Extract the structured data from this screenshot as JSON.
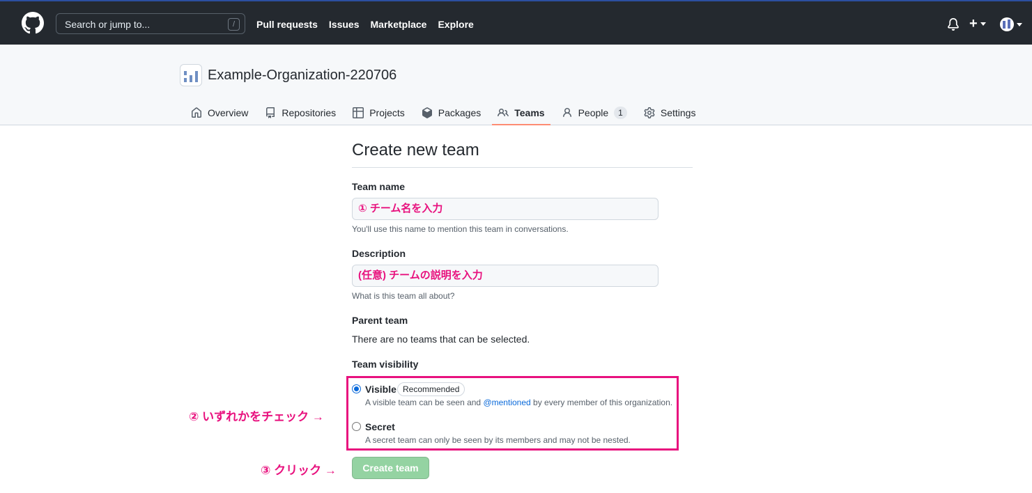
{
  "topbar": {
    "search_placeholder": "Search or jump to...",
    "search_shortcut": "/",
    "nav": [
      "Pull requests",
      "Issues",
      "Marketplace",
      "Explore"
    ],
    "plus_label": "+"
  },
  "org": {
    "name": "Example-Organization-220706",
    "tabs": [
      {
        "label": "Overview",
        "icon": "home-icon"
      },
      {
        "label": "Repositories",
        "icon": "repo-icon"
      },
      {
        "label": "Projects",
        "icon": "table-icon"
      },
      {
        "label": "Packages",
        "icon": "package-icon"
      },
      {
        "label": "Teams",
        "icon": "people-icon",
        "active": true
      },
      {
        "label": "People",
        "icon": "person-icon",
        "counter": "1"
      },
      {
        "label": "Settings",
        "icon": "gear-icon"
      }
    ]
  },
  "form": {
    "title": "Create new team",
    "team_name": {
      "label": "Team name",
      "value": "① チーム名を入力",
      "hint": "You'll use this name to mention this team in conversations."
    },
    "description": {
      "label": "Description",
      "value": "(任意) チームの説明を入力",
      "hint": "What is this team all about?"
    },
    "parent": {
      "label": "Parent team",
      "text": "There are no teams that can be selected."
    },
    "visibility": {
      "label": "Team visibility",
      "visible": {
        "title": "Visible",
        "badge": "Recommended",
        "desc_before": "A visible team can be seen and ",
        "desc_link": "@mentioned",
        "desc_after": " by every member of this organization."
      },
      "secret": {
        "title": "Secret",
        "desc": "A secret team can only be seen by its members and may not be nested."
      }
    },
    "submit_label": "Create team"
  },
  "annotations": {
    "step2": "② いずれかをチェック →",
    "step3": "③ クリック →"
  },
  "colors": {
    "header_bg": "#24292f",
    "annotation": "#e8117e",
    "active_tab_underline": "#fd8c73",
    "button_disabled": "#94d3a2",
    "link": "#0969da"
  }
}
